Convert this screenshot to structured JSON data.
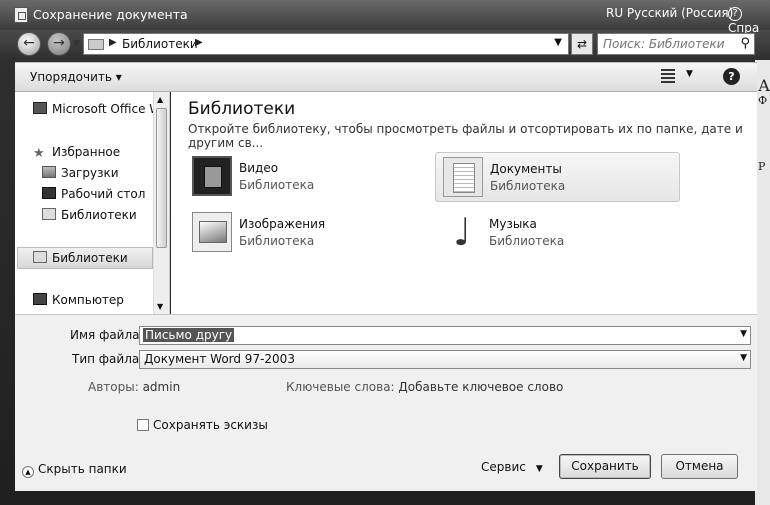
{
  "window": {
    "title": "Сохранение документа",
    "language": "RU Русский (Россия)",
    "help_top": "Спра"
  },
  "background_text": [
    "А",
    "Ф",
    "Р"
  ],
  "nav": {
    "breadcrumb": "Библиотеки",
    "search_placeholder": "Поиск: Библиотеки"
  },
  "toolbar": {
    "organize_label": "Упорядочить ▾",
    "help_label": "?"
  },
  "sidebar": {
    "items": [
      {
        "label": "Microsoft Office W",
        "icon": "office-icon"
      },
      {
        "label": "Избранное",
        "icon": "star-icon"
      },
      {
        "label": "Загрузки",
        "icon": "downloads-icon"
      },
      {
        "label": "Рабочий стол",
        "icon": "desktop-icon"
      },
      {
        "label": "Библиотеки",
        "icon": "library-icon"
      },
      {
        "label": "Библиотеки",
        "icon": "library-icon",
        "selected": true
      },
      {
        "label": "Компьютер",
        "icon": "computer-icon"
      }
    ]
  },
  "main": {
    "title": "Библиотеки",
    "subtitle": "Откройте библиотеку, чтобы просмотреть файлы и отсортировать их по папке, дате и другим св...",
    "libraries": [
      {
        "name": "Видео",
        "type": "Библиотека",
        "icon": "video-icon"
      },
      {
        "name": "Документы",
        "type": "Библиотека",
        "icon": "documents-icon",
        "selected": true
      },
      {
        "name": "Изображения",
        "type": "Библиотека",
        "icon": "images-icon"
      },
      {
        "name": "Музыка",
        "type": "Библиотека",
        "icon": "music-icon"
      }
    ]
  },
  "form": {
    "filename_label": "Имя файла:",
    "filename_value": "Письмо другу",
    "filetype_label": "Тип файла:",
    "filetype_value": "Документ Word 97-2003",
    "authors_label": "Авторы:",
    "authors_value": "admin",
    "keywords_label": "Ключевые слова:",
    "keywords_value": "Добавьте ключевое слово",
    "thumbnails_label": "Сохранять эскизы",
    "thumbnails_checked": false
  },
  "footer": {
    "hide_folders_label": "Скрыть папки",
    "service_label": "Сервис",
    "save_label": "Сохранить",
    "cancel_label": "Отмена"
  }
}
